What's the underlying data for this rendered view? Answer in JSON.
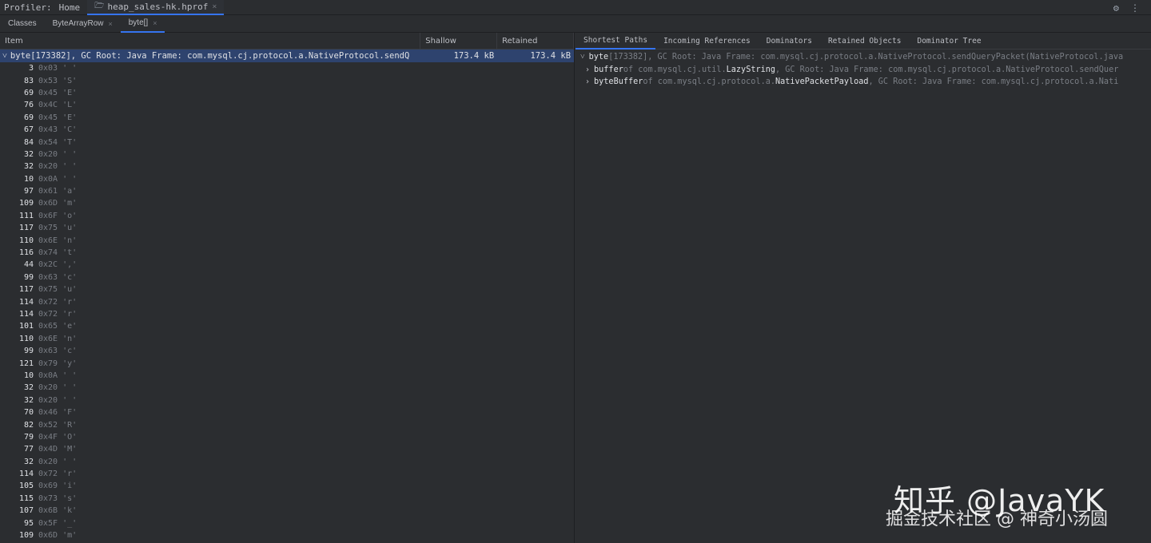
{
  "topbar": {
    "label": "Profiler:",
    "tabs": [
      {
        "label": "Home",
        "icon": "",
        "closable": false
      },
      {
        "label": "heap_sales-hk.hprof",
        "icon": "folder-icon",
        "closable": true
      }
    ],
    "close_glyph": "×",
    "folder_glyph": "🗁",
    "gear_glyph": "⚙",
    "more_glyph": "⋮"
  },
  "subtabs": [
    {
      "label": "Classes"
    },
    {
      "label": "ByteArrayRow"
    },
    {
      "label": "byte[]"
    }
  ],
  "table": {
    "headers": [
      "Item",
      "Shallow",
      "Retained"
    ],
    "selected": {
      "chevron": "˅",
      "item": "byte[173382], GC Root: Java Frame: com.mysql.cj.protocol.a.NativeProtocol.sendQ",
      "shallow": "173.4 kB",
      "retained": "173.4 kB"
    },
    "rows": [
      {
        "n": "3",
        "h": "0x03",
        "c": "' '"
      },
      {
        "n": "83",
        "h": "0x53",
        "c": "'S'"
      },
      {
        "n": "69",
        "h": "0x45",
        "c": "'E'"
      },
      {
        "n": "76",
        "h": "0x4C",
        "c": "'L'"
      },
      {
        "n": "69",
        "h": "0x45",
        "c": "'E'"
      },
      {
        "n": "67",
        "h": "0x43",
        "c": "'C'"
      },
      {
        "n": "84",
        "h": "0x54",
        "c": "'T'"
      },
      {
        "n": "32",
        "h": "0x20",
        "c": "' '"
      },
      {
        "n": "32",
        "h": "0x20",
        "c": "' '"
      },
      {
        "n": "10",
        "h": "0x0A",
        "c": "' '"
      },
      {
        "n": "97",
        "h": "0x61",
        "c": "'a'"
      },
      {
        "n": "109",
        "h": "0x6D",
        "c": "'m'"
      },
      {
        "n": "111",
        "h": "0x6F",
        "c": "'o'"
      },
      {
        "n": "117",
        "h": "0x75",
        "c": "'u'"
      },
      {
        "n": "110",
        "h": "0x6E",
        "c": "'n'"
      },
      {
        "n": "116",
        "h": "0x74",
        "c": "'t'"
      },
      {
        "n": "44",
        "h": "0x2C",
        "c": "','"
      },
      {
        "n": "99",
        "h": "0x63",
        "c": "'c'"
      },
      {
        "n": "117",
        "h": "0x75",
        "c": "'u'"
      },
      {
        "n": "114",
        "h": "0x72",
        "c": "'r'"
      },
      {
        "n": "114",
        "h": "0x72",
        "c": "'r'"
      },
      {
        "n": "101",
        "h": "0x65",
        "c": "'e'"
      },
      {
        "n": "110",
        "h": "0x6E",
        "c": "'n'"
      },
      {
        "n": "99",
        "h": "0x63",
        "c": "'c'"
      },
      {
        "n": "121",
        "h": "0x79",
        "c": "'y'"
      },
      {
        "n": "10",
        "h": "0x0A",
        "c": "' '"
      },
      {
        "n": "32",
        "h": "0x20",
        "c": "' '"
      },
      {
        "n": "32",
        "h": "0x20",
        "c": "' '"
      },
      {
        "n": "70",
        "h": "0x46",
        "c": "'F'"
      },
      {
        "n": "82",
        "h": "0x52",
        "c": "'R'"
      },
      {
        "n": "79",
        "h": "0x4F",
        "c": "'O'"
      },
      {
        "n": "77",
        "h": "0x4D",
        "c": "'M'"
      },
      {
        "n": "32",
        "h": "0x20",
        "c": "' '"
      },
      {
        "n": "114",
        "h": "0x72",
        "c": "'r'"
      },
      {
        "n": "105",
        "h": "0x69",
        "c": "'i'"
      },
      {
        "n": "115",
        "h": "0x73",
        "c": "'s'"
      },
      {
        "n": "107",
        "h": "0x6B",
        "c": "'k'"
      },
      {
        "n": "95",
        "h": "0x5F",
        "c": "'_'"
      },
      {
        "n": "109",
        "h": "0x6D",
        "c": "'m'"
      }
    ]
  },
  "right": {
    "tabs": [
      "Shortest Paths",
      "Incoming References",
      "Dominators",
      "Retained Objects",
      "Dominator Tree"
    ],
    "tree": [
      {
        "chevron": "˅",
        "main": "byte",
        "dim": "[173382], GC Root: Java Frame: com.mysql.cj.protocol.a.NativeProtocol.sendQueryPacket(NativeProtocol.java",
        "hi": "",
        "tail": ""
      },
      {
        "chevron": "›",
        "main": "buffer",
        "dim": " of com.mysql.cj.util.",
        "hi": "LazyString",
        "tail": ", GC Root: Java Frame: com.mysql.cj.protocol.a.NativeProtocol.sendQuer"
      },
      {
        "chevron": "›",
        "main": "byteBuffer",
        "dim": " of com.mysql.cj.protocol.a.",
        "hi": "NativePacketPayload",
        "tail": ", GC Root: Java Frame: com.mysql.cj.protocol.a.Nati"
      }
    ]
  },
  "watermark": {
    "line1": "知乎 @JavaYK",
    "line2": "掘金技术社区 @ 神奇小汤圆"
  },
  "colors": {
    "accent": "#3574f0",
    "selection": "#2e436e",
    "background": "#2b2d30"
  }
}
